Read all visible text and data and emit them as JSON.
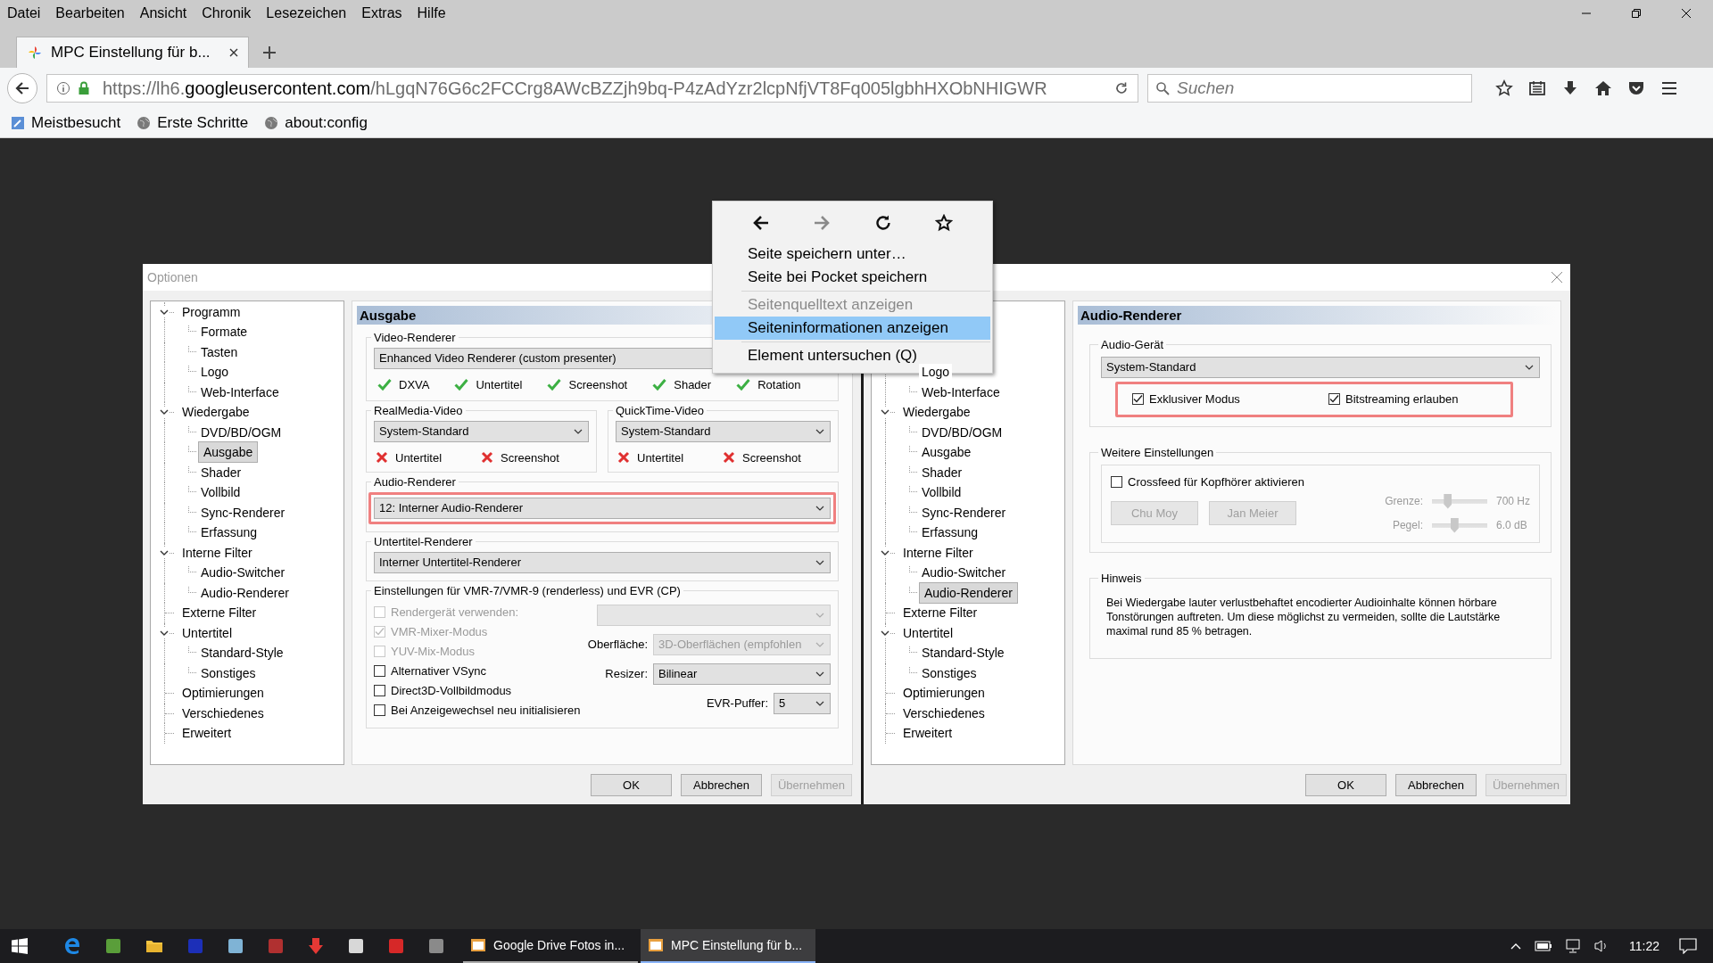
{
  "menu_bar": [
    "Datei",
    "Bearbeiten",
    "Ansicht",
    "Chronik",
    "Lesezeichen",
    "Extras",
    "Hilfe"
  ],
  "tab": {
    "title": "MPC Einstellung für b..."
  },
  "address_bar": {
    "origin_prefix": "https://lh6.",
    "domain": "googleusercontent.com",
    "path": "/hLgqN76G6c2FCCrg8AWcBZZjh9bq-P4zAdYzr2lcpNfjVT8Fq005lgbhHXObNHIGWR"
  },
  "search_field": {
    "placeholder": "Suchen"
  },
  "bookmarks": [
    "Meistbesucht",
    "Erste Schritte",
    "about:config"
  ],
  "options_dialog": {
    "title": "Optionen",
    "left_page": {
      "tree": [
        {
          "label": "Programm",
          "expanded": true,
          "selected": false,
          "children": [
            {
              "label": "Formate",
              "selected": false
            },
            {
              "label": "Tasten",
              "selected": false
            },
            {
              "label": "Logo",
              "selected": false
            },
            {
              "label": "Web-Interface",
              "selected": false
            }
          ]
        },
        {
          "label": "Wiedergabe",
          "expanded": true,
          "selected": false,
          "children": [
            {
              "label": "DVD/BD/OGM",
              "selected": false
            },
            {
              "label": "Ausgabe",
              "selected": true
            },
            {
              "label": "Shader",
              "selected": false
            },
            {
              "label": "Vollbild",
              "selected": false
            },
            {
              "label": "Sync-Renderer",
              "selected": false
            },
            {
              "label": "Erfassung",
              "selected": false
            }
          ]
        },
        {
          "label": "Interne Filter",
          "expanded": true,
          "selected": false,
          "children": [
            {
              "label": "Audio-Switcher",
              "selected": false
            },
            {
              "label": "Audio-Renderer",
              "selected": false
            }
          ]
        },
        {
          "label": "Externe Filter",
          "selected": false
        },
        {
          "label": "Untertitel",
          "expanded": true,
          "selected": false,
          "children": [
            {
              "label": "Standard-Style",
              "selected": false
            },
            {
              "label": "Sonstiges",
              "selected": false
            }
          ]
        },
        {
          "label": "Optimierungen",
          "selected": false
        },
        {
          "label": "Verschiedenes",
          "selected": false
        },
        {
          "label": "Erweitert",
          "selected": false
        }
      ],
      "heading": "Ausgabe",
      "video_renderer": {
        "label": "Video-Renderer",
        "value": "Enhanced Video Renderer (custom presenter)",
        "features": [
          {
            "label": "DXVA",
            "supported": true
          },
          {
            "label": "Untertitel",
            "supported": true
          },
          {
            "label": "Screenshot",
            "supported": true
          },
          {
            "label": "Shader",
            "supported": true
          },
          {
            "label": "Rotation",
            "supported": true
          }
        ]
      },
      "other_renderers": [
        {
          "label": "RealMedia-Video",
          "value": "System-Standard",
          "features": [
            {
              "label": "Untertitel",
              "supported": false
            },
            {
              "label": "Screenshot",
              "supported": false
            }
          ]
        },
        {
          "label": "QuickTime-Video",
          "value": "System-Standard",
          "features": [
            {
              "label": "Untertitel",
              "supported": false
            },
            {
              "label": "Screenshot",
              "supported": false
            }
          ]
        }
      ],
      "audio_renderer": {
        "label": "Audio-Renderer",
        "value": "12: Interner Audio-Renderer",
        "highlighted": true
      },
      "subtitle_renderer": {
        "label": "Untertitel-Renderer",
        "value": "Interner Untertitel-Renderer"
      },
      "vmr_settings": {
        "label": "Einstellungen für VMR-7/VMR-9 (renderless) und EVR (CP)",
        "options": [
          {
            "label": "Rendergerät verwenden:",
            "checked": false,
            "disabled": true
          },
          {
            "label": "VMR-Mixer-Modus",
            "checked": true,
            "disabled": true
          },
          {
            "label": "YUV-Mix-Modus",
            "checked": false,
            "disabled": true
          },
          {
            "label": "Alternativer VSync",
            "checked": false,
            "disabled": false
          },
          {
            "label": "Direct3D-Vollbildmodus",
            "checked": false,
            "disabled": false
          },
          {
            "label": "Bei Anzeigewechsel neu initialisieren",
            "checked": false,
            "disabled": false
          }
        ],
        "fields": [
          {
            "disabled": true
          },
          {
            "label": "Oberfläche:",
            "value": "3D-Oberflächen (empfohlen",
            "disabled": true
          },
          {
            "label": "Resizer:",
            "value": "Bilinear",
            "disabled": false
          },
          {
            "label": "EVR-Puffer:",
            "value": "5",
            "disabled": false
          }
        ]
      },
      "buttons": [
        {
          "label": "OK",
          "disabled": false
        },
        {
          "label": "Abbrechen",
          "disabled": false
        },
        {
          "label": "Übernehmen",
          "disabled": true
        }
      ]
    },
    "right_page": {
      "tree": [
        {
          "children": [
            {
              "label": "Logo",
              "selected": false
            },
            {
              "label": "Web-Interface",
              "selected": false
            }
          ]
        },
        {
          "label": "Wiedergabe",
          "expanded": true,
          "selected": false,
          "children": [
            {
              "label": "DVD/BD/OGM",
              "selected": false
            },
            {
              "label": "Ausgabe",
              "selected": false
            },
            {
              "label": "Shader",
              "selected": false
            },
            {
              "label": "Vollbild",
              "selected": false
            },
            {
              "label": "Sync-Renderer",
              "selected": false
            },
            {
              "label": "Erfassung",
              "selected": false
            }
          ]
        },
        {
          "label": "Interne Filter",
          "expanded": true,
          "selected": false,
          "children": [
            {
              "label": "Audio-Switcher",
              "selected": false
            },
            {
              "label": "Audio-Renderer",
              "selected": true
            }
          ]
        },
        {
          "label": "Externe Filter",
          "selected": false
        },
        {
          "label": "Untertitel",
          "expanded": true,
          "selected": false,
          "children": [
            {
              "label": "Standard-Style",
              "selected": false
            },
            {
              "label": "Sonstiges",
              "selected": false
            }
          ]
        },
        {
          "label": "Optimierungen",
          "selected": false
        },
        {
          "label": "Verschiedenes",
          "selected": false
        },
        {
          "label": "Erweitert",
          "selected": false
        }
      ],
      "heading": "Audio-Renderer",
      "audio_device": {
        "label": "Audio-Gerät",
        "value": "System-Standard",
        "highlighted": true,
        "options": [
          {
            "label": "Exklusiver Modus",
            "checked": true
          },
          {
            "label": "Bitstreaming erlauben",
            "checked": true
          }
        ]
      },
      "more_settings": {
        "label": "Weitere Einstellungen",
        "crossfeed": {
          "label": "Crossfeed für Kopfhörer aktivieren",
          "checked": false
        },
        "presets": [
          {
            "label": "Chu Moy",
            "disabled": true
          },
          {
            "label": "Jan Meier",
            "disabled": true
          }
        ],
        "sliders": [
          {
            "label": "Grenze:",
            "level": 0.28,
            "reading": "700 Hz",
            "disabled": true
          },
          {
            "label": "Pegel:",
            "level": 0.4,
            "reading": "6.0 dB",
            "disabled": true
          }
        ]
      },
      "note": {
        "label": "Hinweis",
        "text": "Bei Wiedergabe lauter verlustbehaftet encodierter Audioinhalte können hörbare Tonstörungen auftreten. Um diese möglichst zu vermeiden, sollte die Lautstärke maximal rund 85 % betragen."
      },
      "buttons": [
        {
          "label": "OK",
          "disabled": false
        },
        {
          "label": "Abbrechen",
          "disabled": false
        },
        {
          "label": "Übernehmen",
          "disabled": true
        }
      ]
    }
  },
  "context_menu": {
    "nav_buttons": [
      {
        "kind": "back",
        "disabled": false
      },
      {
        "kind": "forward",
        "disabled": true
      },
      {
        "kind": "reload",
        "disabled": false
      },
      {
        "kind": "bookmark",
        "disabled": false
      }
    ],
    "items": [
      {
        "kind": "item",
        "label": "Seite speichern unter…",
        "disabled": false,
        "selected": false
      },
      {
        "kind": "item",
        "label": "Seite bei Pocket speichern",
        "disabled": false,
        "selected": false
      },
      {
        "kind": "separator"
      },
      {
        "kind": "item",
        "label": "Seitenquelltext anzeigen",
        "disabled": true,
        "selected": false
      },
      {
        "kind": "item",
        "label": "Seiteninformationen anzeigen",
        "disabled": false,
        "selected": true
      },
      {
        "kind": "separator"
      },
      {
        "kind": "item",
        "label": "Element untersuchen (Q)",
        "disabled": false,
        "selected": false
      }
    ]
  },
  "taskbar": {
    "pinned": [
      {
        "kind": "edge"
      },
      {
        "kind": "app",
        "color": "#5a9e3a"
      },
      {
        "kind": "folder"
      },
      {
        "kind": "app",
        "color": "#1c2fb8"
      },
      {
        "kind": "app",
        "color": "#7fb3d5"
      },
      {
        "kind": "app",
        "color": "#b03030"
      },
      {
        "kind": "download"
      },
      {
        "kind": "app",
        "color": "#d8d8d8"
      },
      {
        "kind": "app",
        "color": "#d62828"
      },
      {
        "kind": "app",
        "color": "#8a8a8a"
      }
    ],
    "tasks": [
      {
        "label": "Google Drive Fotos in...",
        "selected": false
      },
      {
        "label": "MPC Einstellung für b...",
        "selected": true
      }
    ],
    "clock": "11:22"
  }
}
